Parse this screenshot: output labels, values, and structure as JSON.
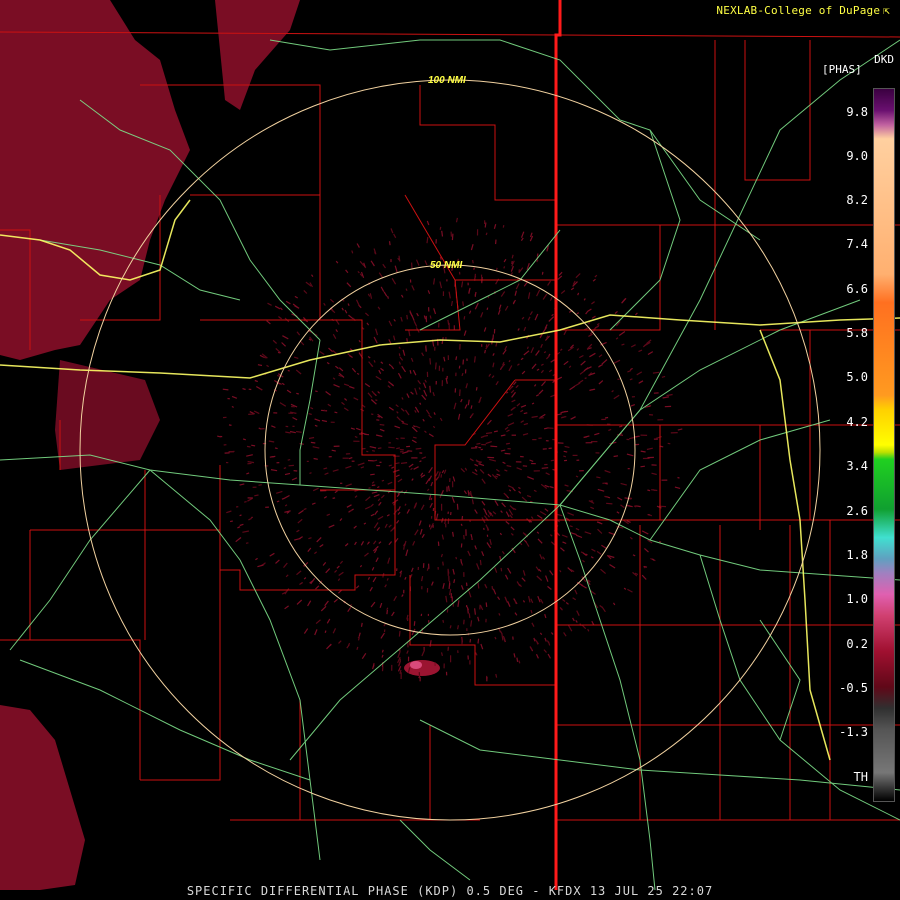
{
  "credit": "NEXLAB-College of DuPage",
  "credit_icon": "cod-logo-icon",
  "legend": {
    "product": "DKD",
    "units": "[PHAS]",
    "labels": [
      "9.8",
      "9.0",
      "8.2",
      "7.4",
      "6.6",
      "5.8",
      "5.0",
      "4.2",
      "3.4",
      "2.6",
      "1.8",
      "1.0",
      "0.2",
      "-0.5",
      "-1.3",
      "TH"
    ]
  },
  "range_rings": [
    "100 NMI",
    "50 NMI"
  ],
  "caption": "SPECIFIC DIFFERENTIAL PHASE (KDP) 0.5 DEG - KFDX 13 JUL 25 22:07",
  "colors": {
    "county_lines": "#cc1111",
    "state_line": "#ff1a1a",
    "highways": "#7ee08a",
    "interstate": "#ffff66",
    "range_rings": "#f2d2a0",
    "echo": "#7a0d24",
    "echo_dark": "#5a0818"
  }
}
